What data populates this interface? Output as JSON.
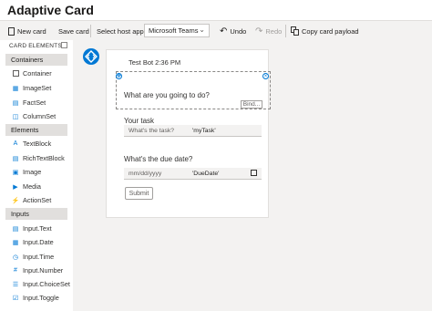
{
  "app": {
    "title": "Adaptive Card"
  },
  "toolbar": {
    "new_card": "New card",
    "save_card": "Save card",
    "host_label": "Select host app:",
    "host_value": "Microsoft Teams",
    "undo": "Undo",
    "redo": "Redo",
    "copy_payload": "Copy card payload"
  },
  "sidebar": {
    "header": "CARD ELEMENTS",
    "categories": [
      {
        "label": "Containers",
        "items": [
          "Container",
          "ImageSet",
          "FactSet",
          "ColumnSet"
        ]
      },
      {
        "label": "Elements",
        "items": [
          "TextBlock",
          "RichTextBlock",
          "Image",
          "Media",
          "ActionSet"
        ]
      },
      {
        "label": "Inputs",
        "items": [
          "Input.Text",
          "Input.Date",
          "Input.Time",
          "Input.Number",
          "Input.ChoiceSet",
          "Input.Toggle"
        ]
      }
    ]
  },
  "card": {
    "header": "Test Bot 2:36 PM",
    "question": "What are you going to do?",
    "bind_label": "Bind...",
    "task_label": "Your task",
    "task_placeholder": "What's the task?",
    "task_id": "'myTask'",
    "due_label": "What's the due date?",
    "date_placeholder": "mm/dd/yyyy",
    "date_id": "'DueDate'",
    "submit": "Submit"
  },
  "colors": {
    "accent": "#0078d4",
    "canvas": "#f3f2f1",
    "category_bg": "#e1dfdd"
  }
}
